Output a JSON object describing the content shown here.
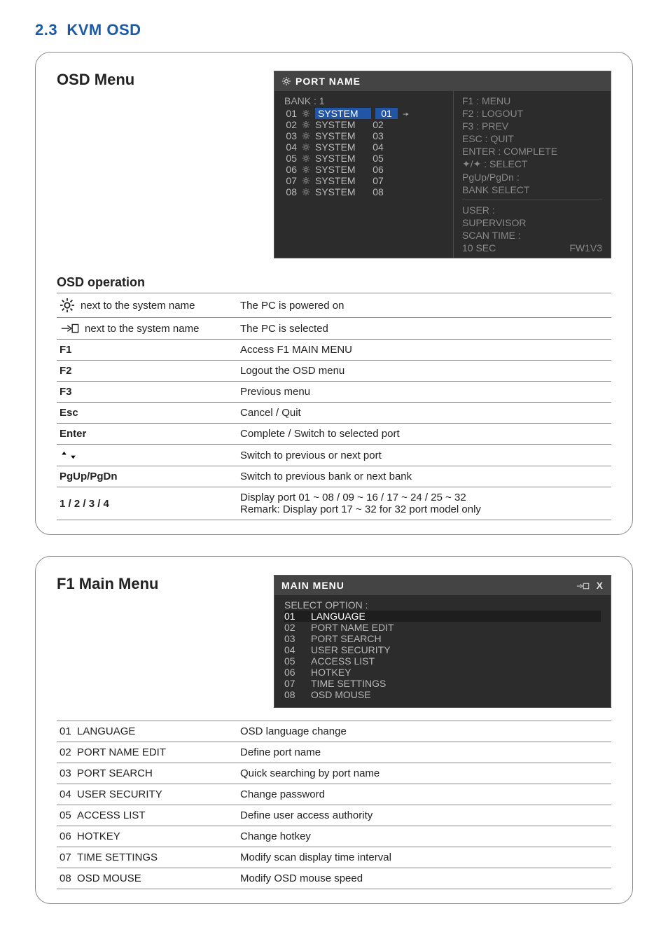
{
  "page": {
    "section_number": "2.3",
    "section_title": "KVM OSD"
  },
  "panel_a": {
    "title": "OSD Menu",
    "osd": {
      "header": "PORT  NAME",
      "bank": "BANK : 1",
      "ports": [
        {
          "n": "01",
          "name": "SYSTEM",
          "r": "01",
          "sel": true
        },
        {
          "n": "02",
          "name": "SYSTEM",
          "r": "02"
        },
        {
          "n": "03",
          "name": "SYSTEM",
          "r": "03"
        },
        {
          "n": "04",
          "name": "SYSTEM",
          "r": "04"
        },
        {
          "n": "05",
          "name": "SYSTEM",
          "r": "05"
        },
        {
          "n": "06",
          "name": "SYSTEM",
          "r": "06"
        },
        {
          "n": "07",
          "name": "SYSTEM",
          "r": "07"
        },
        {
          "n": "08",
          "name": "SYSTEM",
          "r": "08"
        }
      ],
      "help": {
        "l1": "F1 : MENU",
        "l2": "F2 : LOGOUT",
        "l3": "F3 : PREV",
        "l4": "ESC : QUIT",
        "l5": "ENTER : COMPLETE",
        "l6": "✦/✦ : SELECT",
        "l7": "PgUp/PgDn :",
        "l8": "BANK SELECT",
        "u1": "USER :",
        "u2": "SUPERVISOR",
        "u3": "SCAN TIME :",
        "u4": "10 SEC",
        "fw": "FW1V3"
      }
    },
    "op_title": "OSD operation",
    "ops": [
      {
        "k": "next to the system name",
        "d": "The PC is powered on",
        "icon": "sun"
      },
      {
        "k": "next to the system name",
        "d": "The PC is selected",
        "icon": "hand"
      },
      {
        "k": "F1",
        "d": "Access F1 MAIN MENU"
      },
      {
        "k": "F2",
        "d": "Logout the OSD menu"
      },
      {
        "k": "F3",
        "d": "Previous menu"
      },
      {
        "k": "Esc",
        "d": "Cancel / Quit"
      },
      {
        "k": "Enter",
        "d": "Complete / Switch to selected port"
      },
      {
        "k": "✦/✦",
        "d": "Switch to previous or next port",
        "icon": "updown"
      },
      {
        "k": "PgUp/PgDn",
        "d": "Switch to previous bank or next bank"
      },
      {
        "k": "1 / 2 / 3 / 4",
        "d": "Display port  01 ~ 08 / 09 ~ 16 / 17 ~ 24 / 25 ~ 32\nRemark:  Display port 17 ~ 32 for 32 port model only"
      }
    ]
  },
  "panel_b": {
    "title": "F1 Main Menu",
    "mm": {
      "header": "MAIN  MENU",
      "sub": "SELECT OPTION :",
      "items": [
        {
          "n": "01",
          "t": "LANGUAGE",
          "sel": true
        },
        {
          "n": "02",
          "t": "PORT NAME  EDIT"
        },
        {
          "n": "03",
          "t": "PORT SEARCH"
        },
        {
          "n": "04",
          "t": "USER SECURITY"
        },
        {
          "n": "05",
          "t": "ACCESS LIST"
        },
        {
          "n": "06",
          "t": "HOTKEY"
        },
        {
          "n": "07",
          "t": "TIME SETTINGS"
        },
        {
          "n": "08",
          "t": "OSD MOUSE"
        }
      ]
    },
    "desc": [
      {
        "n": "01",
        "k": "LANGUAGE",
        "d": "OSD language change"
      },
      {
        "n": "02",
        "k": "PORT NAME EDIT",
        "d": "Define port name"
      },
      {
        "n": "03",
        "k": "PORT SEARCH",
        "d": "Quick searching by port name"
      },
      {
        "n": "04",
        "k": "USER SECURITY",
        "d": "Change password"
      },
      {
        "n": "05",
        "k": "ACCESS LIST",
        "d": "Define user access authority"
      },
      {
        "n": "06",
        "k": "HOTKEY",
        "d": "Change hotkey"
      },
      {
        "n": "07",
        "k": "TIME SETTINGS",
        "d": "Modify scan display time interval"
      },
      {
        "n": "08",
        "k": "OSD MOUSE",
        "d": "Modify OSD mouse speed"
      }
    ]
  }
}
